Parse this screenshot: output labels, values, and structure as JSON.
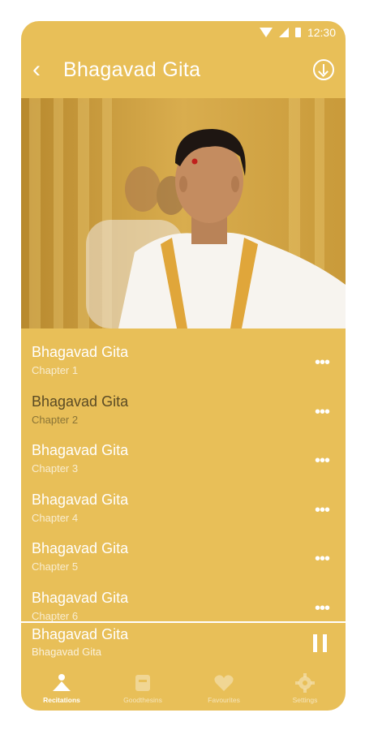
{
  "status": {
    "time": "12:30"
  },
  "header": {
    "title": "Bhagavad Gita",
    "back_icon": "back-arrow-icon",
    "download_icon": "download-icon"
  },
  "hero": {
    "alt": "priest-photo"
  },
  "tracks": [
    {
      "name": "Bhagavad Gita",
      "chapter": "Chapter 1",
      "active": false
    },
    {
      "name": "Bhagavad Gita",
      "chapter": "Chapter 2",
      "active": true
    },
    {
      "name": "Bhagavad Gita",
      "chapter": "Chapter 3",
      "active": false
    },
    {
      "name": "Bhagavad Gita",
      "chapter": "Chapter 4",
      "active": false
    },
    {
      "name": "Bhagavad Gita",
      "chapter": "Chapter 5",
      "active": false
    },
    {
      "name": "Bhagavad Gita",
      "chapter": "Chapter 6",
      "active": false
    }
  ],
  "more_label": "•••",
  "player": {
    "title": "Bhagavad Gita",
    "subtitle": "Bhagavad Gita"
  },
  "tabs": [
    {
      "label": "Recitations",
      "icon": "meditation-icon",
      "active": true
    },
    {
      "label": "Goodthesins",
      "icon": "book-icon",
      "active": false
    },
    {
      "label": "Favourites",
      "icon": "heart-icon",
      "active": false
    },
    {
      "label": "Settings",
      "icon": "gear-icon",
      "active": false
    }
  ],
  "colors": {
    "background": "#e8bf58",
    "text": "#ffffff",
    "active_text": "#5a4a24"
  }
}
